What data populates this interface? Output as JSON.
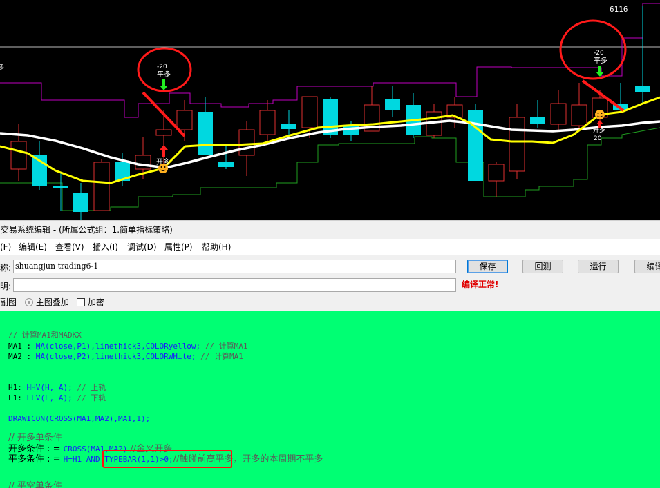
{
  "chart": {
    "price_label": "6116",
    "annotations": {
      "sell_signal_left": {
        "value": "-20",
        "label": "平多"
      },
      "buy_signal_left": {
        "label": "开多"
      },
      "sell_signal_right": {
        "value": "-20",
        "label": "平多"
      },
      "buy_signal_right": {
        "label": "开多",
        "value": "20"
      },
      "left_edge_label": "多"
    },
    "colors": {
      "background": "#000000",
      "ma1_yellow": "#ffff00",
      "ma2_white": "#ffffff",
      "upper_band": "#c000c0",
      "lower_band": "#20a020",
      "bull_candle": "#e03030",
      "bear_candle": "#00d8e0",
      "signal_circle": "#ff2020"
    }
  },
  "window": {
    "title": "交易系统编辑 - (所属公式组：1.简单指标策略)"
  },
  "menu": [
    {
      "label": "(F)"
    },
    {
      "label": "编辑(E)"
    },
    {
      "label": "查看(V)"
    },
    {
      "label": "插入(I)"
    },
    {
      "label": "调试(D)"
    },
    {
      "label": "属性(P)"
    },
    {
      "label": "帮助(H)"
    }
  ],
  "form": {
    "name_label": "称:",
    "name_value": "shuangjun trading6-1",
    "desc_label": "明:",
    "desc_value": "",
    "chart_type_label": "副图",
    "overlay_option": "主图叠加",
    "encrypt_option": "加密",
    "buttons": {
      "save": "保存",
      "reset": "回测",
      "run": "运行",
      "compile": "编译"
    },
    "status": "编译正常!"
  },
  "code": {
    "line1": "// 计算MA1和MADKX",
    "line2_a": "MA1 : ",
    "line2_b": "MA(close,P1),linethick3,COLORyellow;",
    "line2_c": " // 计算MA1",
    "line3_a": "MA2 : ",
    "line3_b": "MA(close,P2),linethick3,COLORWHite;",
    "line3_c": " // 计算MA1",
    "line4_a": "H1: ",
    "line4_b": "HHV(H, A);",
    "line4_c": " // 上轨",
    "line5_a": "L1: ",
    "line5_b": "LLV(L, A);",
    "line5_c": " // 下轨",
    "line6": "DRAWICON(CROSS(MA1,MA2),MA1,1);",
    "line7": "// 开多单条件",
    "line8_a": "开多条件 : = ",
    "line8_b": "CROSS(MA1,MA2)",
    "line8_c": " //金叉开多",
    "line9_a": "平多条件 : = ",
    "line9_b": "H=H1 AND TYPEBAR(1,1)>0;",
    "line9_c": "//触碰前高平多，开多的本周期不平多",
    "line10": "// 平空单条件"
  }
}
